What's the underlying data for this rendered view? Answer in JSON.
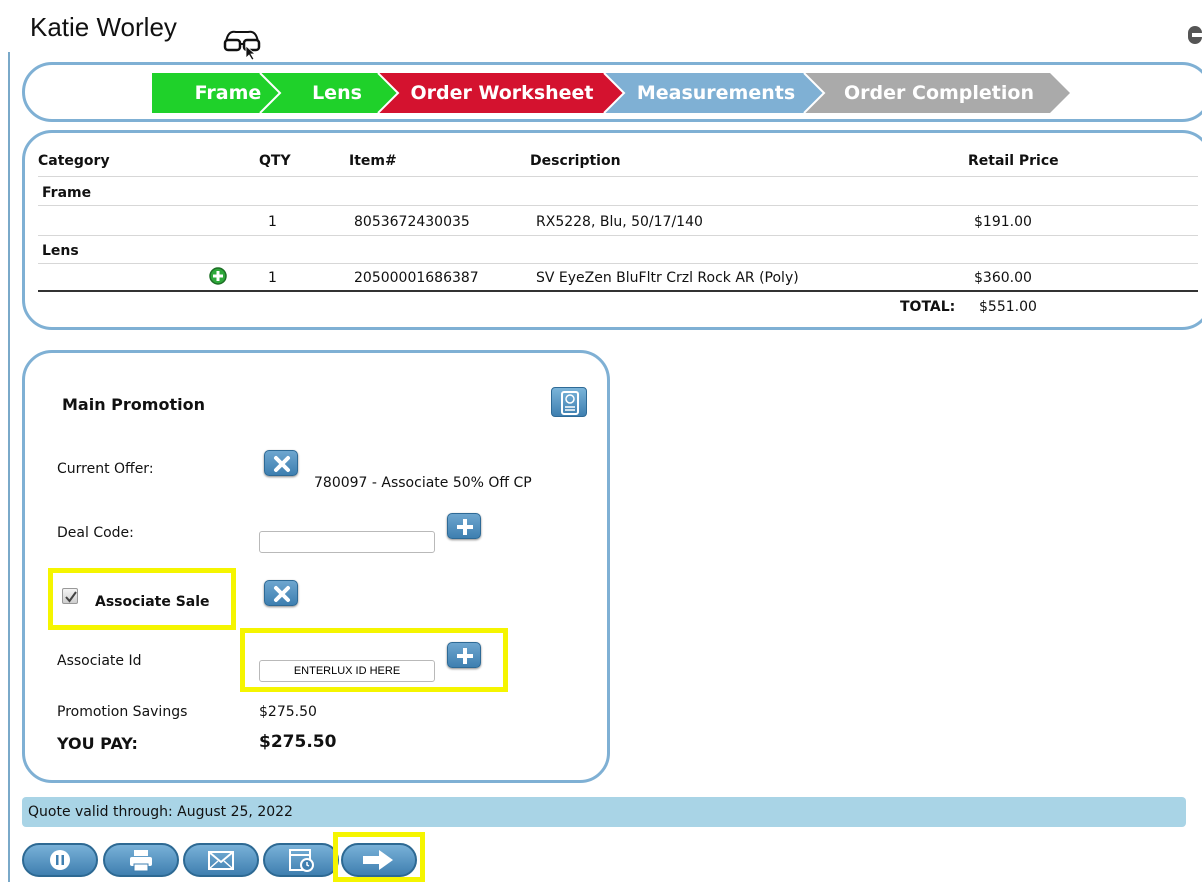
{
  "header": {
    "user_name": "Katie Worley"
  },
  "steps": [
    {
      "label": "Frame",
      "color": "#1fd12a"
    },
    {
      "label": "Lens",
      "color": "#1fd12a"
    },
    {
      "label": "Order Worksheet",
      "color": "#d4122f"
    },
    {
      "label": "Measurements",
      "color": "#7fb0d4"
    },
    {
      "label": "Order Completion",
      "color": "#aaaaaa"
    }
  ],
  "table": {
    "headers": {
      "category": "Category",
      "qty": "QTY",
      "item": "Item#",
      "description": "Description",
      "price": "Retail Price"
    },
    "groups": [
      {
        "category": "Frame",
        "qty": "1",
        "item": "8053672430035",
        "description": "RX5228, Blu, 50/17/140",
        "price": "$191.00"
      },
      {
        "category": "Lens",
        "qty": "1",
        "item": "20500001686387",
        "description": "SV EyeZen BluFltr Crzl Rock AR (Poly)",
        "price": "$360.00"
      }
    ],
    "total_label": "TOTAL:",
    "total_value": "$551.00"
  },
  "promo": {
    "title": "Main Promotion",
    "current_offer_label": "Current Offer:",
    "current_offer_value": "780097 - Associate 50% Off CP",
    "deal_code_label": "Deal Code:",
    "deal_code_value": "",
    "associate_sale_label": "Associate Sale",
    "associate_sale_checked": true,
    "associate_id_label": "Associate Id",
    "associate_id_value": "ENTERLUX ID HERE",
    "savings_label": "Promotion Savings",
    "savings_value": "$275.50",
    "you_pay_label": "YOU PAY:",
    "you_pay_value": "$275.50"
  },
  "footer": {
    "quote_text": "Quote valid through: August 25, 2022"
  },
  "colors": {
    "highlight": "#f5f500",
    "panel_border": "#7fb0d4",
    "button_blue": "#3f7fb0"
  }
}
